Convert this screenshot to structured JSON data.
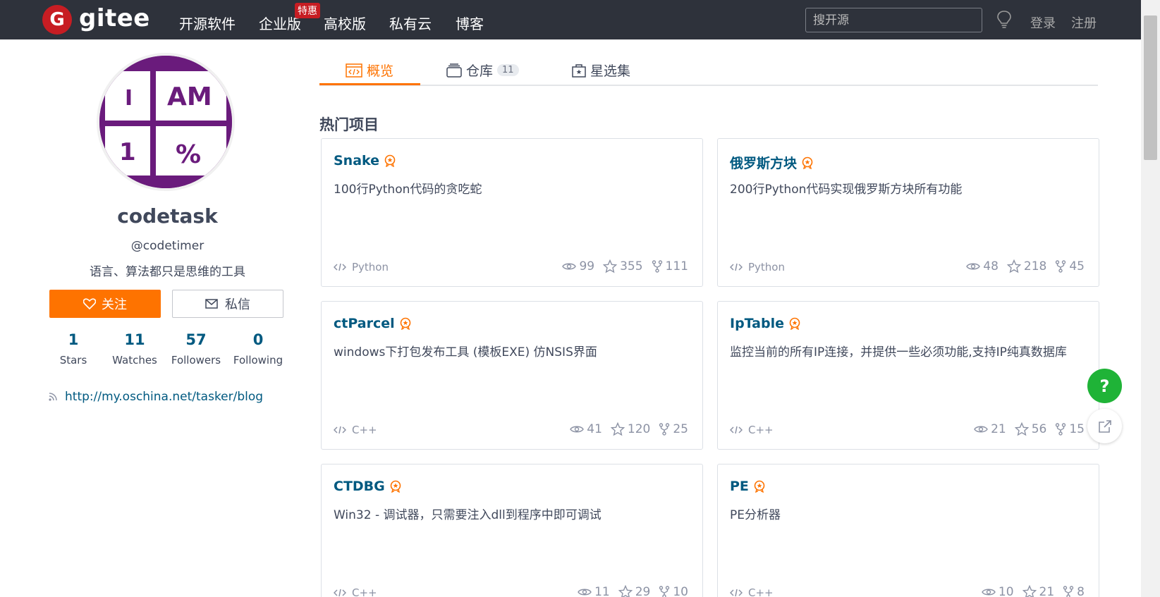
{
  "header": {
    "logo_text": "gitee",
    "nav": [
      "开源软件",
      "企业版",
      "高校版",
      "私有云",
      "博客"
    ],
    "nav_badge": "特惠",
    "search_placeholder": "搜开源",
    "login": "登录",
    "register": "注册"
  },
  "profile": {
    "avatar_text": [
      "I",
      "AM",
      "1",
      "%"
    ],
    "name": "codetask",
    "handle": "@codetimer",
    "bio": "语言、算法都只是思维的工具",
    "follow_label": "关注",
    "message_label": "私信",
    "stats": [
      {
        "num": "1",
        "label": "Stars"
      },
      {
        "num": "11",
        "label": "Watches"
      },
      {
        "num": "57",
        "label": "Followers"
      },
      {
        "num": "0",
        "label": "Following"
      }
    ],
    "blog_url": "http://my.oschina.net/tasker/blog"
  },
  "tabs": [
    {
      "label": "概览",
      "active": true
    },
    {
      "label": "仓库",
      "count": "11"
    },
    {
      "label": "星选集"
    }
  ],
  "section_title": "热门项目",
  "projects": [
    {
      "name": "Snake",
      "desc": "100行Python代码的贪吃蛇",
      "lang": "Python",
      "watch": "99",
      "star": "355",
      "fork": "111"
    },
    {
      "name": "俄罗斯方块",
      "desc": "200行Python代码实现俄罗斯方块所有功能",
      "lang": "Python",
      "watch": "48",
      "star": "218",
      "fork": "45"
    },
    {
      "name": "ctParcel",
      "desc": "windows下打包发布工具 (模板EXE) 仿NSIS界面",
      "lang": "C++",
      "watch": "41",
      "star": "120",
      "fork": "25"
    },
    {
      "name": "IpTable",
      "desc": "监控当前的所有IP连接，并提供一些必须功能,支持IP纯真数据库",
      "lang": "C++",
      "watch": "21",
      "star": "56",
      "fork": "15"
    },
    {
      "name": "CTDBG",
      "desc": "Win32 - 调试器，只需要注入dll到程序中即可调试",
      "lang": "C++",
      "watch": "11",
      "star": "29",
      "fork": "10"
    },
    {
      "name": "PE",
      "desc": "PE分析器",
      "lang": "C++",
      "watch": "10",
      "star": "21",
      "fork": "8"
    }
  ],
  "fab": {
    "help": "?"
  },
  "colors": {
    "accent": "#fe7300",
    "link": "#005980",
    "topbar": "#2e323b",
    "brand": "#c71d23",
    "help": "#1fb337"
  }
}
